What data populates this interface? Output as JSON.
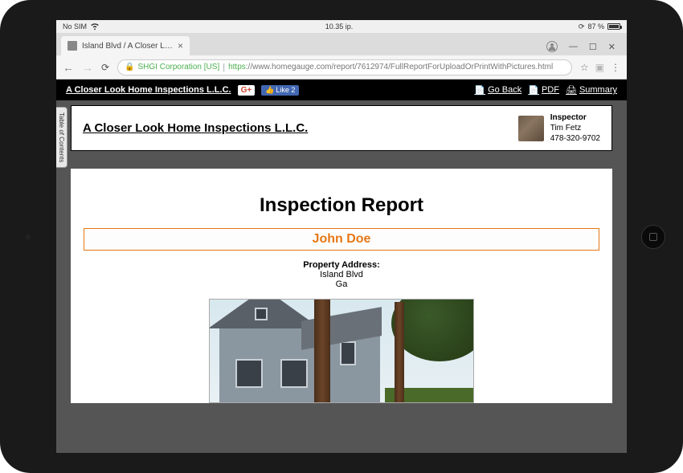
{
  "status": {
    "carrier": "No SIM",
    "time": "10.35 ip.",
    "battery": "87 %"
  },
  "browser": {
    "tab_title": "Island Blvd / A Closer Look",
    "secure_tag": "SHGI Corporation [US]",
    "url_prefix": "https",
    "url_rest": "://www.homegauge.com/report/7612974/FullReportForUploadOrPrintWithPictures.html"
  },
  "toolbar": {
    "company": "A Closer Look Home Inspections L.L.C.",
    "gplus": "G+",
    "fb_like": "Like 2",
    "go_back": "Go Back",
    "pdf": "PDF",
    "summary": "Summary"
  },
  "toc_label": "Table of Contents",
  "header": {
    "company": "A Closer Look Home Inspections L.L.C.",
    "inspector_label": "Inspector",
    "inspector_name": "Tim Fetz",
    "inspector_phone": "478-320-9702"
  },
  "report": {
    "title": "Inspection Report",
    "client": "John Doe",
    "address_label": "Property Address:",
    "address_line1": "Island Blvd",
    "address_line2": "Ga"
  }
}
